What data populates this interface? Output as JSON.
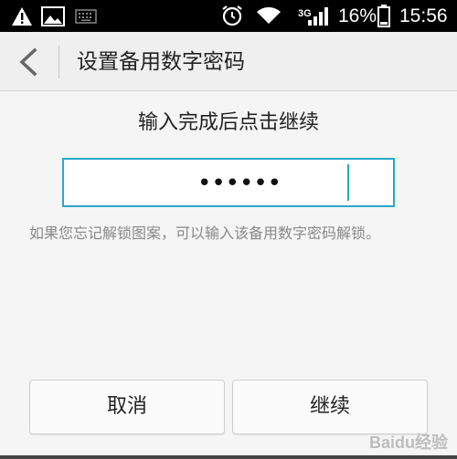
{
  "status_bar": {
    "network": "3G",
    "battery": "16%",
    "time": "15:56",
    "icons": [
      "warning-icon",
      "image-icon",
      "keyboard-icon",
      "alarm-icon",
      "wifi-icon",
      "signal-icon",
      "battery-icon"
    ]
  },
  "header": {
    "title": "设置备用数字密码",
    "back_icon": "back-arrow-icon"
  },
  "prompt": "输入完成后点击继续",
  "pin_input": {
    "masked_value": "••••••"
  },
  "hint": "如果您忘记解锁图案，可以输入该备用数字密码解锁。",
  "buttons": {
    "cancel": "取消",
    "continue": "继续"
  },
  "watermark": "Baidu经验",
  "colors": {
    "accent": "#2aa7c7",
    "status_bar": "#000000"
  }
}
